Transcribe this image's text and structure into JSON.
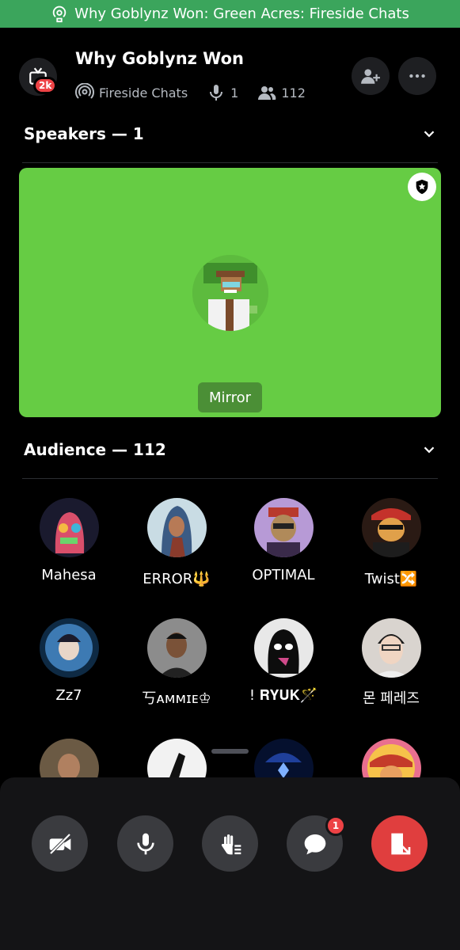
{
  "banner": {
    "text": "Why Goblynz Won: Green Acres: Fireside Chats",
    "color": "#3ba55c"
  },
  "header": {
    "title": "Why Goblynz Won",
    "server_badge": "2k",
    "channel": "Fireside Chats",
    "speaker_count": "1",
    "listener_count": "112"
  },
  "speakers": {
    "heading": "Speakers — 1",
    "items": [
      {
        "name": "Mirror",
        "card_color": "#66cc44"
      }
    ]
  },
  "audience": {
    "heading": "Audience — 112",
    "items": [
      {
        "name": "Mahesa"
      },
      {
        "name": "ERROR🔱"
      },
      {
        "name": "OPTIMAL"
      },
      {
        "name": "Twist🔀"
      },
      {
        "name": "Zz7"
      },
      {
        "name": "丂ᴀᴍᴍɪᴇ♔"
      },
      {
        "name": "!  𝐑𝐘𝐔𝐊🪄"
      },
      {
        "name": "몬 페레즈"
      },
      {
        "name": ""
      },
      {
        "name": ""
      },
      {
        "name": ""
      },
      {
        "name": ""
      }
    ]
  },
  "controls": {
    "icons": [
      "video-off-icon",
      "microphone-icon",
      "raise-hand-icon",
      "chat-icon",
      "leave-icon"
    ],
    "chat_unread": "1",
    "leave_color": "#e03e3e"
  }
}
